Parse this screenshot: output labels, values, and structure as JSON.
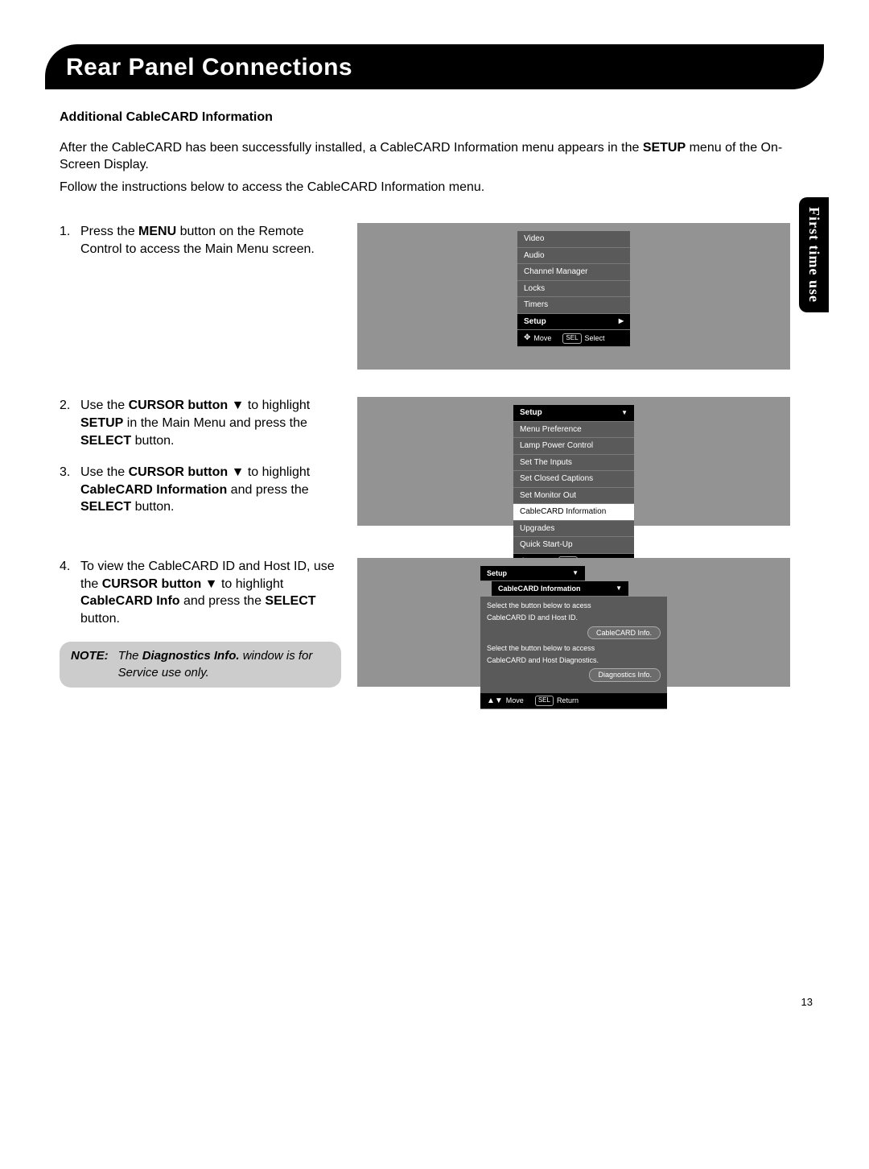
{
  "banner_title": "Rear Panel Connections",
  "side_tab": "First time use",
  "subhead": "Additional CableCARD Information",
  "intro_line1": "After the CableCARD has been successfully installed, a CableCARD Information menu appears in the ",
  "intro_bold1": "SETUP",
  "intro_line1_tail": " menu of the On-Screen Display.",
  "intro_line2": "Follow the instructions below to access the CableCARD Information menu.",
  "step1_num": "1.",
  "step1_a": "Press the ",
  "step1_b": "MENU",
  "step1_c": " button on the Remote Control to access the Main Menu screen.",
  "step2_num": "2.",
  "step2_a": "Use the ",
  "step2_b": "CURSOR button ▼",
  "step2_c": " to highlight ",
  "step2_d": "SETUP",
  "step2_e": " in the Main Menu and press the ",
  "step2_f": "SELECT",
  "step2_g": " button.",
  "step3_num": "3.",
  "step3_a": "Use the ",
  "step3_b": "CURSOR button ▼",
  "step3_c": " to highlight ",
  "step3_d": "CableCARD Information",
  "step3_e": " and press the ",
  "step3_f": "SELECT",
  "step3_g": " button.",
  "step4_num": "4.",
  "step4_a": "To view the CableCARD ID and Host ID, use the ",
  "step4_b": "CURSOR button ▼",
  "step4_c": " to highlight ",
  "step4_d": "CableCARD Info",
  "step4_e": " and press the ",
  "step4_f": "SELECT",
  "step4_g": " button.",
  "note_label": "NOTE:",
  "note_a": "The ",
  "note_b": "Diagnostics Info.",
  "note_c": " window is for Service use only.",
  "screen1": {
    "items": [
      "Video",
      "Audio",
      "Channel Manager",
      "Locks",
      "Timers",
      "Setup"
    ],
    "footer_move": "Move",
    "footer_sel": "SEL",
    "footer_select": "Select"
  },
  "screen2": {
    "header": "Setup",
    "items": [
      "Menu Preference",
      "Lamp Power Control",
      "Set The Inputs",
      "Set Closed Captions",
      "Set Monitor Out",
      "CableCARD Information",
      "Upgrades",
      "Quick Start-Up"
    ],
    "highlight_index": 5,
    "footer_move": "Move",
    "footer_sel": "SEL",
    "footer_select": "Select"
  },
  "screen3": {
    "header1": "Setup",
    "header2": "CableCARD Information",
    "line1": "Select the button below to acess",
    "line2": "CableCARD ID and Host ID.",
    "btn1": "CableCARD Info.",
    "line3": "Select the button below to access",
    "line4": "CableCARD and Host Diagnostics.",
    "btn2": "Diagnostics Info.",
    "footer_move": "Move",
    "footer_sel": "SEL",
    "footer_return": "Return"
  },
  "page_number": "13"
}
